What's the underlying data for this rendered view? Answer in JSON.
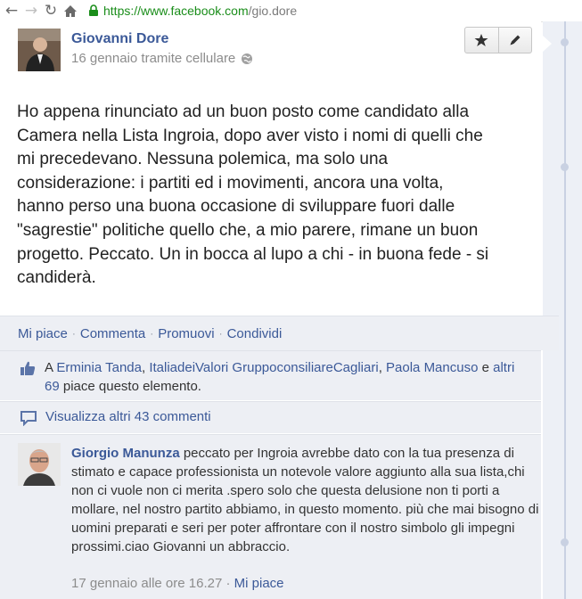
{
  "browser": {
    "url_secure": "https://www.facebook.com",
    "url_path": "/gio.dore"
  },
  "post": {
    "author": "Giovanni Dore",
    "meta": "16 gennaio tramite cellulare",
    "text": "Ho appena rinunciato ad un buon posto come candidato alla\nCamera nella Lista Ingroia, dopo aver visto i nomi di quelli che\nmi precedevano. Nessuna polemica, ma solo una\nconsiderazione: i partiti ed i movimenti, ancora una volta,\nhanno perso una buona occasione di sviluppare fuori dalle\n\"sagrestie\" politiche quello che, a mio parere, rimane un buon\nprogetto. Peccato. Un in bocca al lupo a chi - in buona fede - si\ncandiderà."
  },
  "actions": {
    "like": "Mi piace",
    "comment": "Commenta",
    "promote": "Promuovi",
    "share": "Condividi",
    "separator": "·"
  },
  "likes": {
    "prefix": "A",
    "user1": "Erminia Tanda",
    "sep1": ",",
    "user2": "ItaliadeiValori GruppoconsiliareCagliari",
    "sep2": ",",
    "user3": "Paola Mancuso",
    "and": "e",
    "others": "altri 69",
    "suffix": "piace questo elemento."
  },
  "view_more": "Visualizza altri 43 commenti",
  "comment": {
    "author": "Giorgio Manunza",
    "text": "peccato per Ingroia avrebbe dato con la tua presenza di stimato e capace professionista un notevole valore aggiunto alla sua lista,chi non ci vuole non ci merita .spero solo che questa delusione non ti porti a mollare, nel nostro partito abbiamo, in questo momento. più che mai bisogno di uomini preparati e seri per poter affrontare con il nostro simbolo gli impegni prossimi.ciao Giovanni un abbraccio.",
    "timestamp": "17 gennaio alle ore 16.27",
    "separator": "·",
    "like": "Mi piace"
  },
  "icons": {
    "back": "back-arrow-icon",
    "forward": "forward-arrow-icon",
    "reload": "reload-icon",
    "home": "home-icon",
    "lock": "lock-icon",
    "globe": "globe-icon",
    "star": "star-icon",
    "pencil": "pencil-icon",
    "thumb": "thumbs-up-icon",
    "comment": "comment-bubble-icon"
  },
  "colors": {
    "link": "#3b5998",
    "secure": "#1a8d1a",
    "ufi_background": "#edeff4"
  }
}
